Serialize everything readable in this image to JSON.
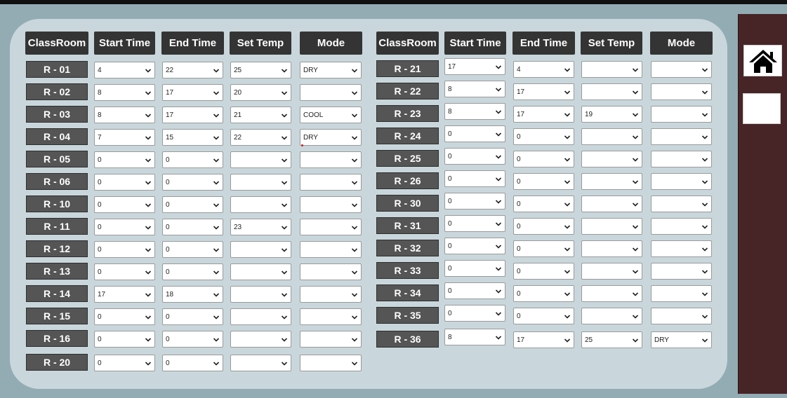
{
  "headers": {
    "classroom": "ClassRoom",
    "start_time": "Start Time",
    "end_time": "End Time",
    "set_temp": "Set Temp",
    "mode": "Mode"
  },
  "left_rows": [
    {
      "room": "R - 01",
      "start": "4",
      "end": "22",
      "temp": "25",
      "mode": "DRY"
    },
    {
      "room": "R - 02",
      "start": "8",
      "end": "17",
      "temp": "20",
      "mode": ""
    },
    {
      "room": "R - 03",
      "start": "8",
      "end": "17",
      "temp": "21",
      "mode": "COOL"
    },
    {
      "room": "R - 04",
      "start": "7",
      "end": "15",
      "temp": "22",
      "mode": "DRY"
    },
    {
      "room": "R - 05",
      "start": "0",
      "end": "0",
      "temp": "",
      "mode": ""
    },
    {
      "room": "R - 06",
      "start": "0",
      "end": "0",
      "temp": "",
      "mode": ""
    },
    {
      "room": "R - 10",
      "start": "0",
      "end": "0",
      "temp": "",
      "mode": ""
    },
    {
      "room": "R - 11",
      "start": "0",
      "end": "0",
      "temp": "23",
      "mode": ""
    },
    {
      "room": "R - 12",
      "start": "0",
      "end": "0",
      "temp": "",
      "mode": ""
    },
    {
      "room": "R - 13",
      "start": "0",
      "end": "0",
      "temp": "",
      "mode": ""
    },
    {
      "room": "R - 14",
      "start": "17",
      "end": "18",
      "temp": "",
      "mode": ""
    },
    {
      "room": "R - 15",
      "start": "0",
      "end": "0",
      "temp": "",
      "mode": ""
    },
    {
      "room": "R - 16",
      "start": "0",
      "end": "0",
      "temp": "",
      "mode": ""
    },
    {
      "room": "R - 20",
      "start": "0",
      "end": "0",
      "temp": "",
      "mode": ""
    }
  ],
  "right_rows": [
    {
      "room": "R - 21",
      "start": "17",
      "end": "4",
      "temp": "",
      "mode": ""
    },
    {
      "room": "R - 22",
      "start": "8",
      "end": "17",
      "temp": "",
      "mode": ""
    },
    {
      "room": "R - 23",
      "start": "8",
      "end": "17",
      "temp": "19",
      "mode": ""
    },
    {
      "room": "R - 24",
      "start": "0",
      "end": "0",
      "temp": "",
      "mode": ""
    },
    {
      "room": "R - 25",
      "start": "0",
      "end": "0",
      "temp": "",
      "mode": ""
    },
    {
      "room": "R - 26",
      "start": "0",
      "end": "0",
      "temp": "",
      "mode": ""
    },
    {
      "room": "R - 30",
      "start": "0",
      "end": "0",
      "temp": "",
      "mode": ""
    },
    {
      "room": "R - 31",
      "start": "0",
      "end": "0",
      "temp": "",
      "mode": ""
    },
    {
      "room": "R - 32",
      "start": "0",
      "end": "0",
      "temp": "",
      "mode": ""
    },
    {
      "room": "R - 33",
      "start": "0",
      "end": "0",
      "temp": "",
      "mode": ""
    },
    {
      "room": "R - 34",
      "start": "0",
      "end": "0",
      "temp": "",
      "mode": ""
    },
    {
      "room": "R - 35",
      "start": "0",
      "end": "0",
      "temp": "",
      "mode": ""
    },
    {
      "room": "R - 36",
      "start": "8",
      "end": "17",
      "temp": "25",
      "mode": "DRY"
    }
  ],
  "sidebar": {
    "home_icon": "home-icon",
    "blank_button": ""
  },
  "colors": {
    "background": "#93acb4",
    "panel": "#c9d7dc",
    "header": "#343434",
    "room_label": "#555555",
    "sidebar": "#472527"
  }
}
